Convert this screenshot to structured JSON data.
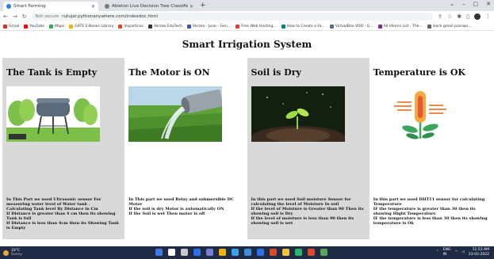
{
  "browser": {
    "tabs": [
      {
        "title": "Smart Farming",
        "color": "#2f7ae5"
      },
      {
        "title": "Ableton Live Decision Tree Classifier",
        "color": "#7a7a7a"
      }
    ],
    "new_tab_label": "+",
    "window_controls": [
      "⌄",
      "–",
      "▢",
      "✕"
    ],
    "address": {
      "security": "Not secure",
      "url": "rutujar.pythonanywhere.com/indexdoc.html"
    },
    "bookmarks": [
      {
        "label": "Gmail",
        "color": "#d93025"
      },
      {
        "label": "YouTube",
        "color": "#ff0000"
      },
      {
        "label": "Maps",
        "color": "#34a853"
      },
      {
        "label": "GATE E-Books Library",
        "color": "#f4b400"
      },
      {
        "label": "Imparticus",
        "color": "#e64a19"
      },
      {
        "label": "Verzeo EduTech",
        "color": "#333333"
      },
      {
        "label": "Verzeo - June - Gen...",
        "color": "#3f51b5"
      },
      {
        "label": "Free Web Hosting...",
        "color": "#e53935"
      },
      {
        "label": "How to Create a Fa...",
        "color": "#00897b"
      },
      {
        "label": "VirtualBox VDD - G...",
        "color": "#546e7a"
      },
      {
        "label": "All Idioms List - The...",
        "color": "#8e24aa"
      },
      {
        "label": "Hack gmail passwo...",
        "color": "#616161"
      }
    ]
  },
  "page": {
    "title": "Smart Irrigation System",
    "cards": [
      {
        "heading": "The Tank is Empty",
        "bg": "#ffffff",
        "image": "tank-icon",
        "lines": [
          "In This Part we used Ultrasonic sensor For measuring water level of Water tank .",
          "Calculating Tank level By Distance in Cm",
          "If Distance is greater than 4 cm then its showing Tank is full",
          "If Distance is less than 4cm then its Showing Tank is Empty"
        ]
      },
      {
        "heading": "The Motor is ON",
        "bg": "#d9d9d9",
        "image": "water-pipe-icon",
        "lines": [
          "In This part we used Relay and submersible DC Motor",
          "If the soil is dry Motor is automatically ON",
          "If the Soil is wet Then motor is off"
        ]
      },
      {
        "heading": "Soil is Dry",
        "bg": "#ffffff",
        "image": "sprout-icon",
        "lines": [
          "In this part we used Soil moisture Sensor for calculating the level of Moisture In soil",
          "If the level of Moisture is Greater than 90 Then its showing soil is Dry",
          "If the level of moisture is less than 90 then its showing soil is wet"
        ]
      },
      {
        "heading": "Temperature is OK",
        "bg": "#d9d9d9",
        "image": "thermometer-plant-icon",
        "lines": [
          "In this part we used DHT11 sensor for calculating Temperature",
          "IF the temperature is greater than 30 then its showing Hight Temperature",
          "IF the temperature is less than 30 then its showing temperature is Ok"
        ]
      }
    ]
  },
  "taskbar": {
    "weather": {
      "temp": "33°C",
      "desc": "Sunny"
    },
    "app_colors": [
      "#ffffff",
      "#3d7be0",
      "#f0c040",
      "#2f6fe8",
      "#e04a2a",
      "#f5b300",
      "#3aa0f0",
      "#5aa55a",
      "#d84b24",
      "#7b7bd8",
      "#3e8ee0",
      "#29b36d"
    ],
    "lang": "ENG\nIN",
    "time": "11:53 AM",
    "date": "23-03-2022"
  }
}
